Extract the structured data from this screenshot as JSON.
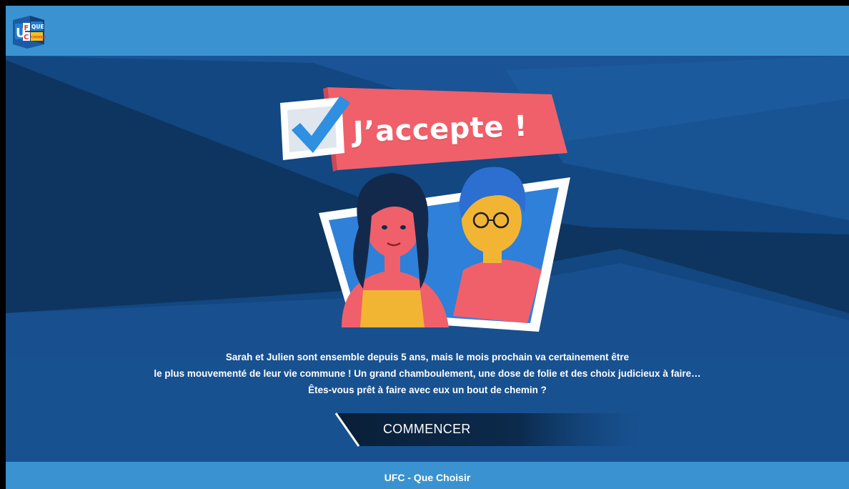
{
  "header": {
    "logo_letters": [
      "U",
      "F",
      "C",
      "QUE",
      "CHOISIR"
    ]
  },
  "game": {
    "title": "J’accepte !",
    "intro_lines": [
      "Sarah et Julien sont ensemble depuis 5 ans, mais le mois prochain va certainement être",
      "le plus mouvementé de leur vie commune ! Un grand chamboulement, une dose de folie et des choix judicieux à faire…",
      "Êtes-vous prêt à faire avec eux un bout de chemin ?"
    ],
    "start_label": "COMMENCER"
  },
  "footer": {
    "text": "UFC - Que Choisir"
  },
  "colors": {
    "header_bg": "#3a93d0",
    "stage_bg": "#0f3f72",
    "banner_pink": "#f0606a",
    "check_blue": "#2f8fe0",
    "frame_white": "#ffffff"
  }
}
